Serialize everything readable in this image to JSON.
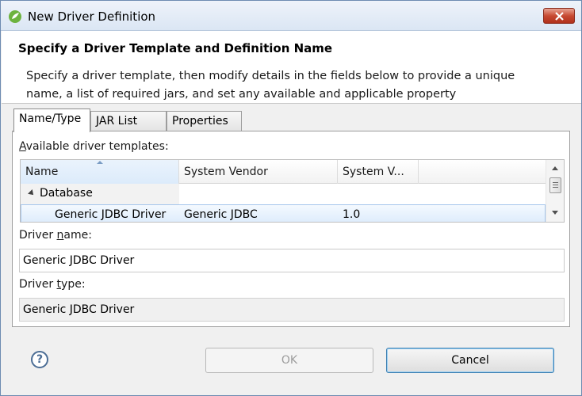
{
  "window": {
    "title": "New Driver Definition"
  },
  "header": {
    "title": "Specify a Driver Template and Definition Name",
    "description": "Specify a driver template, then modify details in the fields below to provide a unique name, a list of required jars, and set any available and applicable property"
  },
  "tabs": [
    {
      "label": "Name/Type",
      "active": true
    },
    {
      "label": "JAR List",
      "active": false
    },
    {
      "label": "Properties",
      "active": false
    }
  ],
  "templates": {
    "label_prefix": "A",
    "label_rest": "vailable driver templates:",
    "columns": [
      "Name",
      "System Vendor",
      "System V..."
    ],
    "sorted_column": "Name",
    "category": "Database",
    "rows": [
      {
        "name": "Generic JDBC Driver",
        "vendor": "Generic JDBC",
        "version": "1.0",
        "selected": true
      }
    ]
  },
  "driver_name": {
    "label_pre": "Driver ",
    "label_mnemonic": "n",
    "label_post": "ame:",
    "value": "Generic JDBC Driver"
  },
  "driver_type": {
    "label_pre": "Driver ",
    "label_mnemonic": "t",
    "label_post": "ype:",
    "value": "Generic JDBC Driver"
  },
  "buttons": {
    "help": "?",
    "ok": "OK",
    "cancel": "Cancel"
  },
  "colors": {
    "selection": "#dcebfc",
    "title_bar": "#dbe6f4",
    "close_button": "#c74a32"
  }
}
